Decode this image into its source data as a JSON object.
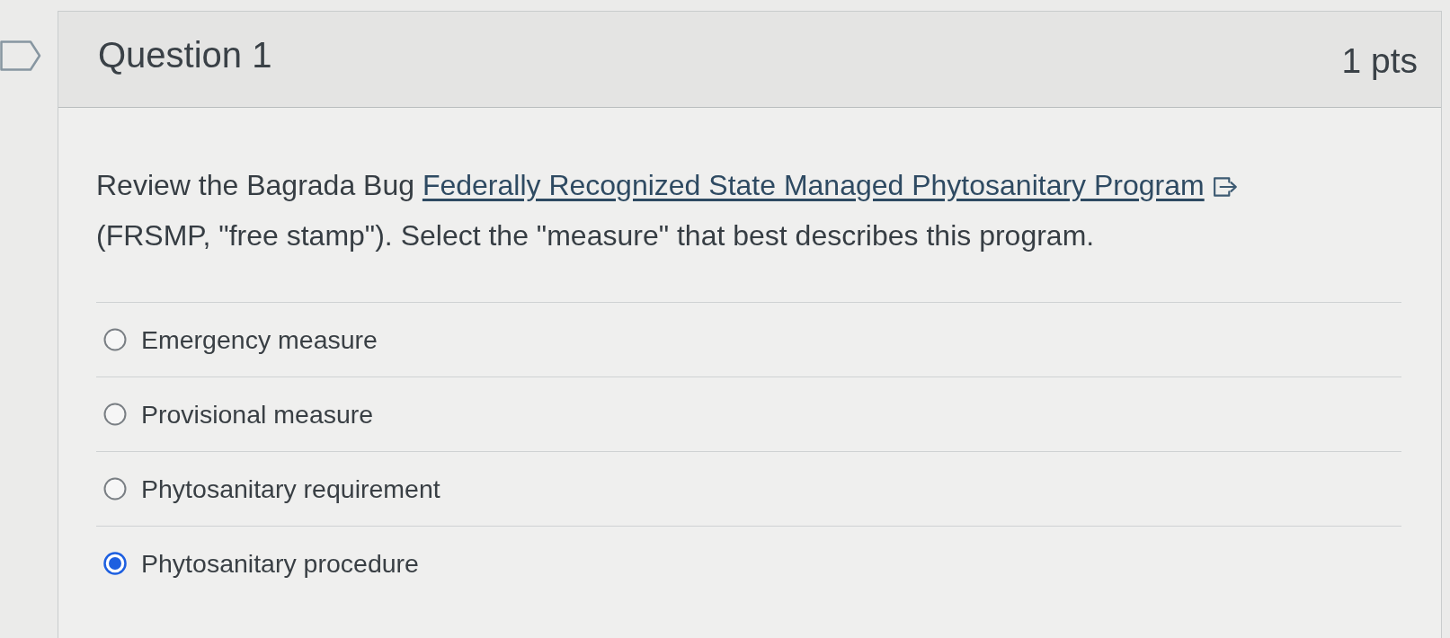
{
  "question": {
    "title": "Question 1",
    "points": "1 pts",
    "text_before_link": "Review the Bagrada Bug",
    "link": "Federally Recognized State Managed Phytosanitary Program",
    "text_after_link": "(FRSMP, \"free stamp\"). Select the \"measure\" that best describes this program."
  },
  "answers": [
    {
      "label": "Emergency measure",
      "selected": false
    },
    {
      "label": "Provisional measure",
      "selected": false
    },
    {
      "label": "Phytosanitary requirement",
      "selected": false
    },
    {
      "label": "Phytosanitary procedure",
      "selected": true
    }
  ]
}
